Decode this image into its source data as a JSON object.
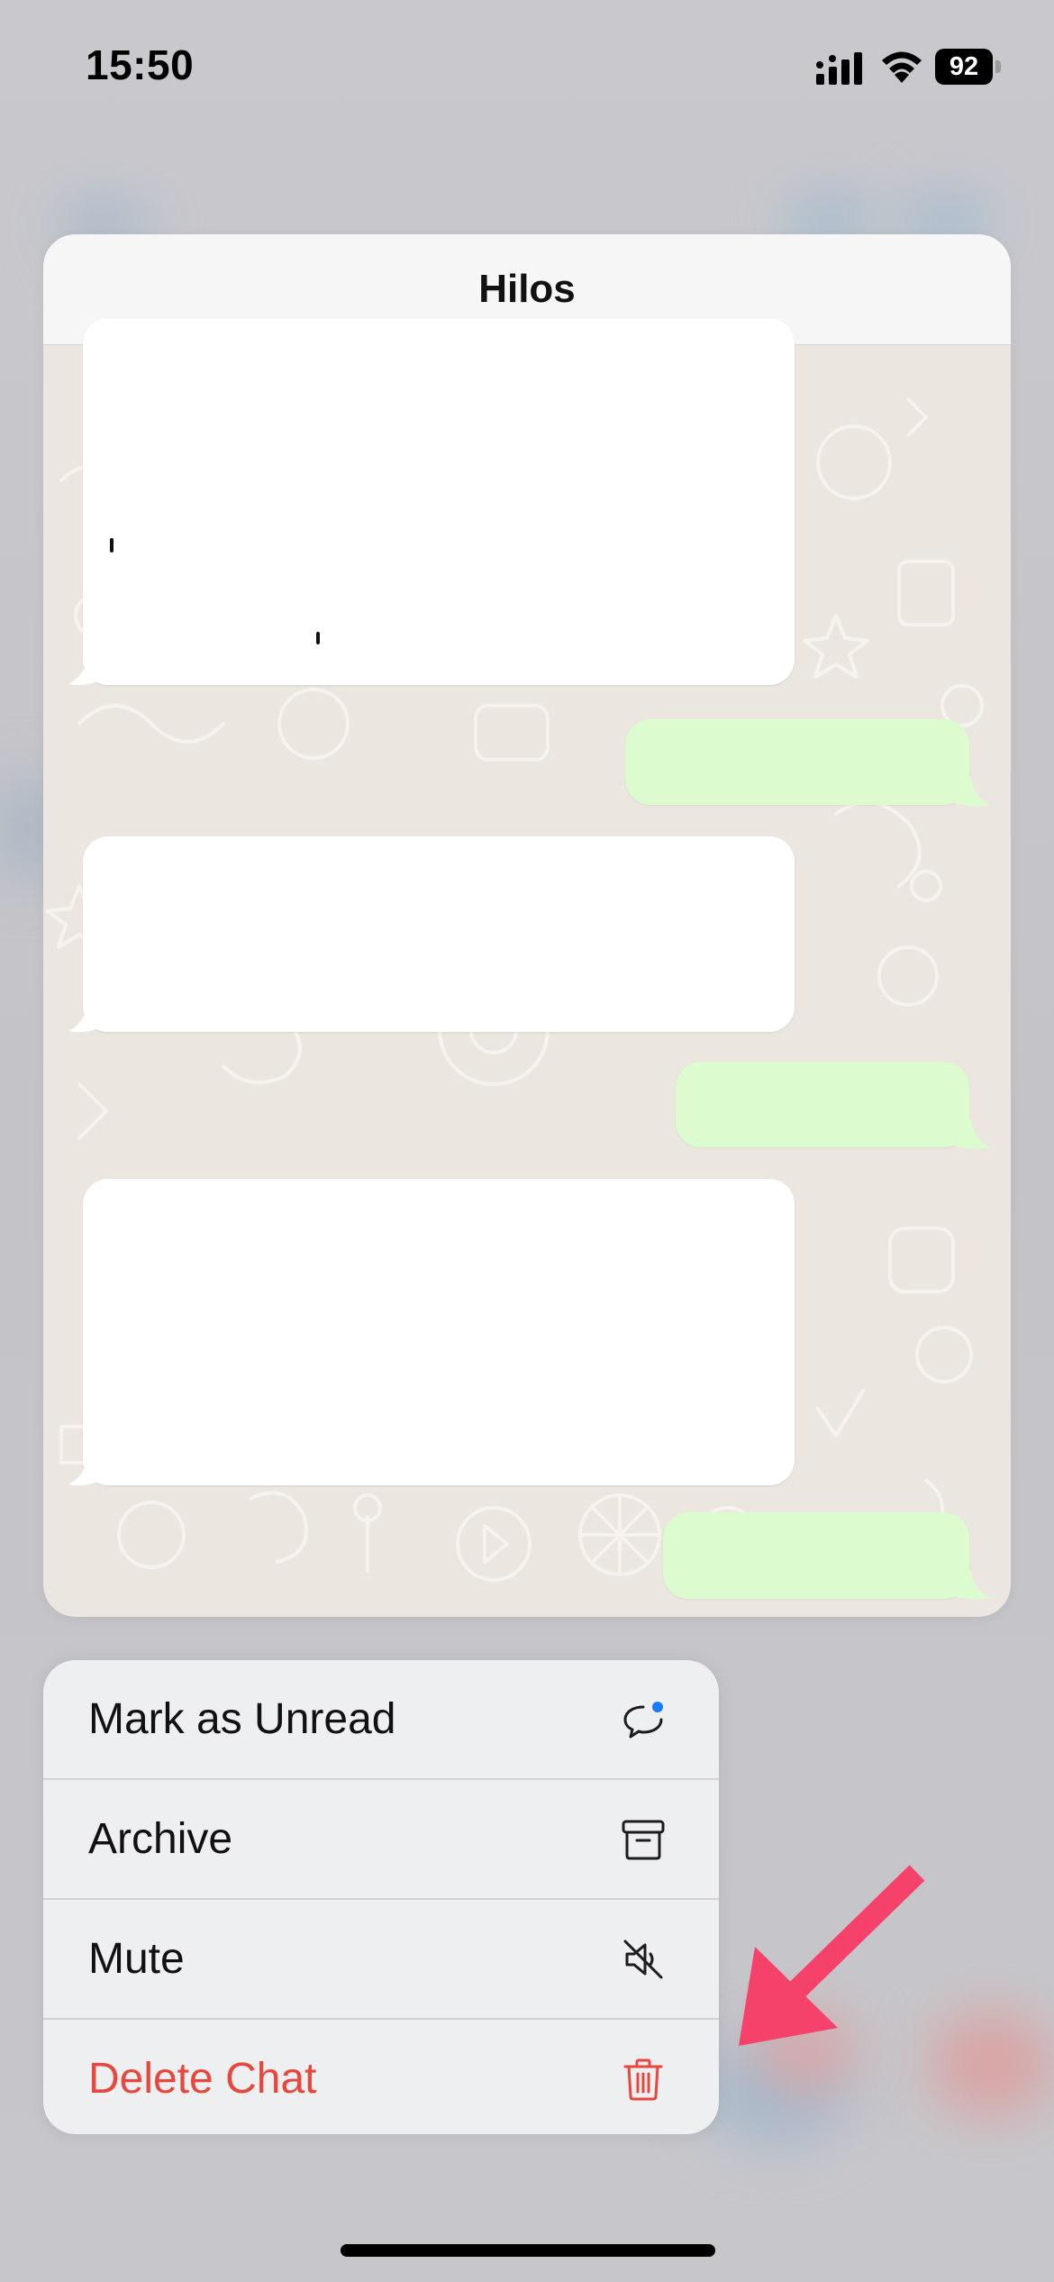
{
  "status_bar": {
    "time": "15:50",
    "battery_level": "92",
    "icons": [
      "signal-icon",
      "wifi-icon",
      "battery-icon"
    ]
  },
  "preview": {
    "title": "Hilos"
  },
  "context_menu": {
    "items": [
      {
        "label": "Mark as Unread",
        "icon": "unread-chat-bubble-icon"
      },
      {
        "label": "Archive",
        "icon": "archive-box-icon"
      },
      {
        "label": "Mute",
        "icon": "speaker-muted-icon"
      },
      {
        "label": "Delete Chat",
        "icon": "trash-icon",
        "destructive": true
      }
    ]
  },
  "colors": {
    "destructive": "#e8473d",
    "annotation_arrow": "#f5426b",
    "incoming_bubble": "#ffffff",
    "outgoing_bubble": "#dcfbcf",
    "chat_background": "#ebe6df",
    "unread_dot": "#1a7cf5"
  }
}
